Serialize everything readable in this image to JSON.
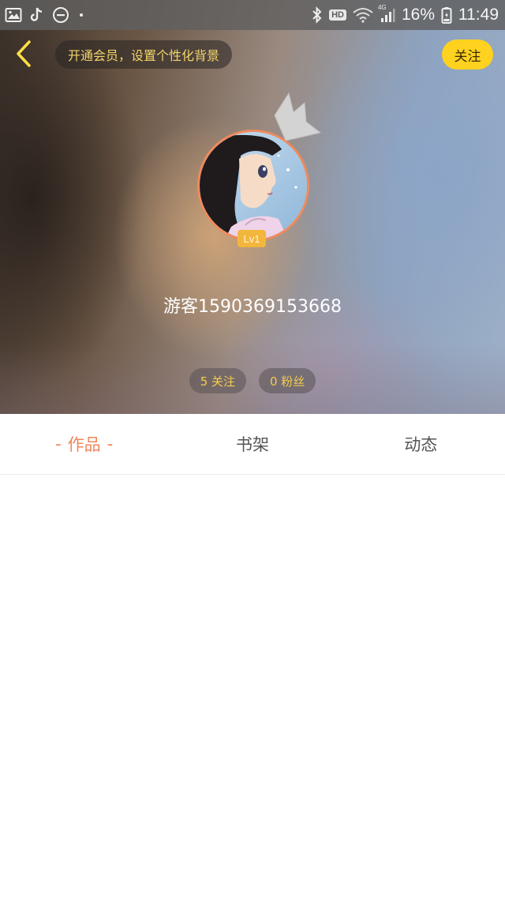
{
  "status_bar": {
    "battery_percent": "16%",
    "time": "11:49",
    "hd_label": "HD",
    "network_label": "4G",
    "icons": [
      "gallery-icon",
      "tiktok-icon",
      "do-not-disturb-icon",
      "dot-icon",
      "bluetooth-icon",
      "hd-icon",
      "wifi-icon",
      "signal-icon",
      "battery-icon"
    ]
  },
  "header": {
    "back_icon": "chevron-left-icon",
    "vip_banner": "开通会员，设置个性化背景",
    "follow_button": "关注"
  },
  "profile": {
    "level": "Lv1",
    "username": "游客1590369153668",
    "following": "5 关注",
    "fans": "0 粉丝"
  },
  "tabs": [
    {
      "label": "作品",
      "active": true
    },
    {
      "label": "书架",
      "active": false
    },
    {
      "label": "动态",
      "active": false
    }
  ],
  "tab_dash": "-",
  "colors": {
    "accent_orange": "#f0865c",
    "follow_yellow": "#ffd21f",
    "banner_text": "#f3d46b",
    "stat_text": "#f3cd4d",
    "level_badge": "#f3b63c"
  }
}
